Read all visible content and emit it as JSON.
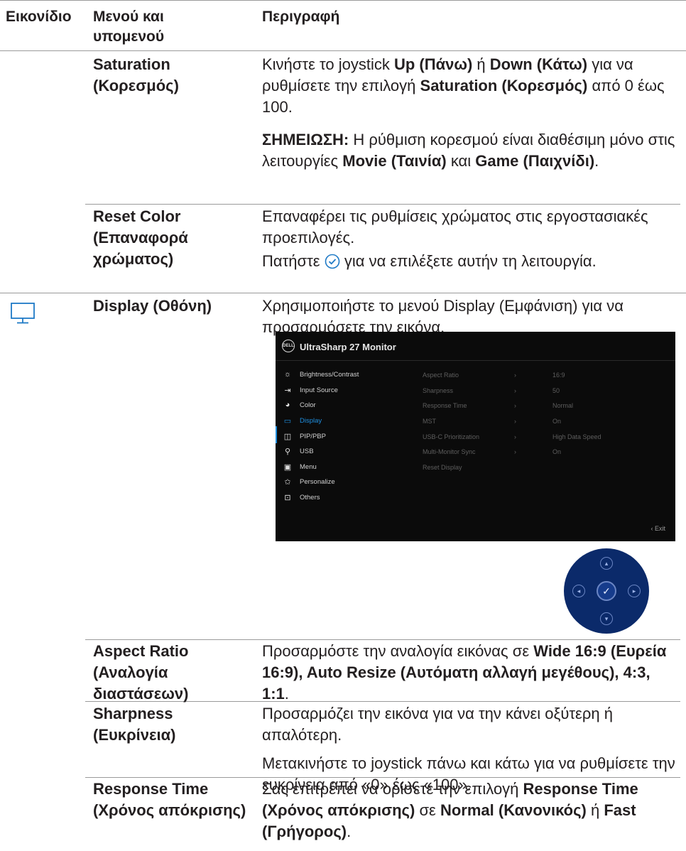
{
  "header": {
    "col1": "Εικονίδιο",
    "col2": "Μενού και υπομενού",
    "col3": "Περιγραφή"
  },
  "rows": {
    "saturation": {
      "menu": "Saturation (Κορεσμός)",
      "d1a": "Κινήστε το joystick ",
      "d1b": "Up (Πάνω)",
      "d1c": " ή ",
      "d1d": "Down (Κάτω)",
      "d1e": " για να ρυθμίσετε την επιλογή ",
      "d1f": "Saturation (Κορεσμός)",
      "d1g": " από 0 έως 100.",
      "n1": "ΣΗΜΕΙΩΣΗ:",
      "n2": " Η ρύθμιση κορεσμού είναι διαθέσιμη μόνο στις λειτουργίες ",
      "n3": "Movie (Ταινία)",
      "n4": " και ",
      "n5": "Game (Παιχνίδι)",
      "n6": "."
    },
    "reset_color": {
      "menu": "Reset Color (Επαναφορά χρώματος)",
      "d1": "Επαναφέρει τις ρυθμίσεις χρώματος στις εργοστασιακές προεπιλογές.",
      "d2a": "Πατήστε ",
      "d2b": " για να επιλέξετε αυτήν τη λειτουργία."
    },
    "display": {
      "menu": "Display (Οθόνη)",
      "d1": "Χρησιμοποιήστε το μενού Display (Εμφάνιση) για να προσαρμόσετε την εικόνα."
    },
    "aspect_ratio": {
      "menu": "Aspect Ratio (Αναλογία διαστάσεων)",
      "d1": "Προσαρμόστε την αναλογία εικόνας σε ",
      "d2": "Wide 16:9 (Ευρεία 16:9), Auto Resize (Αυτόματη αλλαγή μεγέθους), 4:3, 1:1",
      "d3": "."
    },
    "sharpness": {
      "menu": "Sharpness (Ευκρίνεια)",
      "d1": "Προσαρμόζει την εικόνα για να την κάνει οξύτερη ή απαλότερη.",
      "d2": "Μετακινήστε το joystick πάνω και κάτω για να ρυθμίσετε την ευκρίνεια από «0» έως «100»."
    },
    "response_time": {
      "menu": "Response Time (Χρόνος απόκρισης)",
      "d1": "Σας επιτρέπει να ορίσετε την επιλογή ",
      "d2": "Response Time (Χρόνος απόκρισης)",
      "d3": " σε ",
      "d4": "Normal (Κανονικός)",
      "d5": " ή ",
      "d6": "Fast (Γρήγορος)",
      "d7": "."
    }
  },
  "osd": {
    "logo": "DELL",
    "title": "UltraSharp 27 Monitor",
    "menu": [
      "Brightness/Contrast",
      "Input Source",
      "Color",
      "Display",
      "PIP/PBP",
      "USB",
      "Menu",
      "Personalize",
      "Others"
    ],
    "sub_labels": [
      "Aspect Ratio",
      "Sharpness",
      "Response Time",
      "MST",
      "USB-C Prioritization",
      "Multi-Monitor Sync",
      "Reset Display"
    ],
    "sub_values": [
      "16:9",
      "50",
      "Normal",
      "On",
      "High Data Speed",
      "On"
    ],
    "exit": "Exit"
  },
  "colors": {
    "accent": "#1f8fe0",
    "icon": "#1f7ac6",
    "rule": "#9a9a9a"
  }
}
